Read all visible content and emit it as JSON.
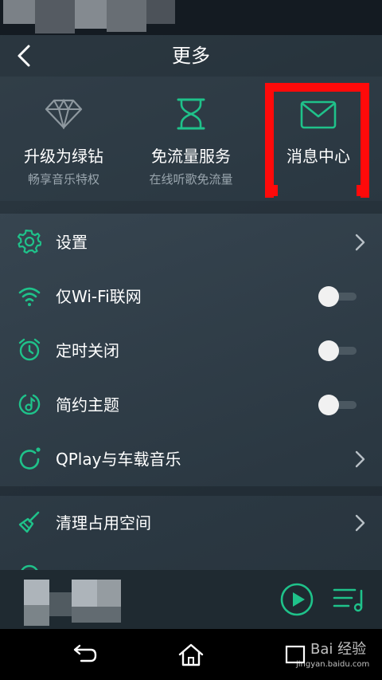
{
  "header": {
    "title": "更多"
  },
  "features": [
    {
      "label": "升级为绿钻",
      "sub": "畅享音乐特权"
    },
    {
      "label": "免流量服务",
      "sub": "在线听歌免流量"
    },
    {
      "label": "消息中心",
      "sub": ""
    }
  ],
  "list": [
    {
      "label": "设置",
      "icon": "gear-icon",
      "control": "chevron"
    },
    {
      "label": "仅Wi-Fi联网",
      "icon": "wifi-icon",
      "control": "toggle",
      "on": false
    },
    {
      "label": "定时关闭",
      "icon": "alarm-clock-icon",
      "control": "toggle",
      "on": false
    },
    {
      "label": "简约主题",
      "icon": "music-note-circle-icon",
      "control": "toggle",
      "on": false
    },
    {
      "label": "QPlay与车载音乐",
      "icon": "qplay-icon",
      "control": "chevron"
    },
    {
      "label": "清理占用空间",
      "icon": "broom-icon",
      "control": "chevron"
    }
  ],
  "colors": {
    "accent": "#1fc28a",
    "highlight": "#ff0a0a",
    "background": "#34424d"
  },
  "watermark": {
    "text": "Bai 经验",
    "url": "jingyan.baidu.com"
  }
}
